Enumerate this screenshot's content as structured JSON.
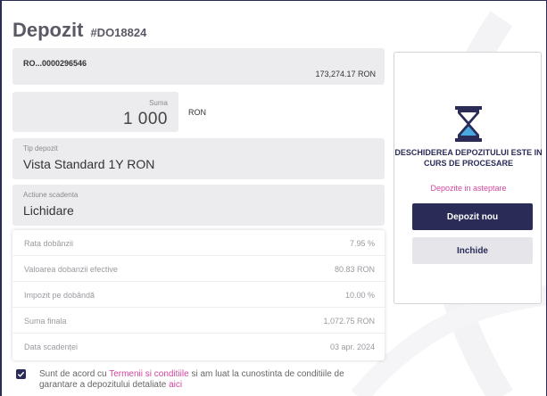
{
  "page": {
    "title": "Depozit",
    "code": "#DO18824"
  },
  "account": {
    "number": "RO...0000296546",
    "balance": "173,274.17 RON"
  },
  "amount": {
    "label": "Suma",
    "value": "1 000",
    "currency": "RON"
  },
  "deposit_type": {
    "label": "Tip depozit",
    "value": "Vista Standard 1Y RON"
  },
  "maturity_action": {
    "label": "Actiune scadenta",
    "value": "Lichidare"
  },
  "details": [
    {
      "label": "Rata dobânzii",
      "value": "7.95 %"
    },
    {
      "label": "Valoarea dobanzii efective",
      "value": "80.83 RON"
    },
    {
      "label": "Impozit pe dobândă",
      "value": "10.00 %"
    },
    {
      "label": "Suma finala",
      "value": "1,072.75 RON"
    },
    {
      "label": "Data scadenței",
      "value": "03 apr. 2024"
    }
  ],
  "agreement": {
    "checked": true,
    "text_1": "Sunt de acord cu ",
    "link_terms": "Termenii si conditiile",
    "text_2": " si am luat la cunostinta de conditiile de garantare a depozitului detaliate ",
    "link_here": "aici"
  },
  "status_panel": {
    "icon": "hourglass-icon",
    "message": "DESCHIDEREA DEPOZITULUI ESTE IN CURS DE PROCESARE",
    "pending_link": "Depozite in asteptare",
    "new_deposit_button": "Depozit nou",
    "close_button": "Inchide"
  },
  "colors": {
    "primary": "#2a2c57",
    "accent": "#d0469e",
    "field_bg": "#ececee",
    "hourglass_fill": "#4aa8e0"
  }
}
